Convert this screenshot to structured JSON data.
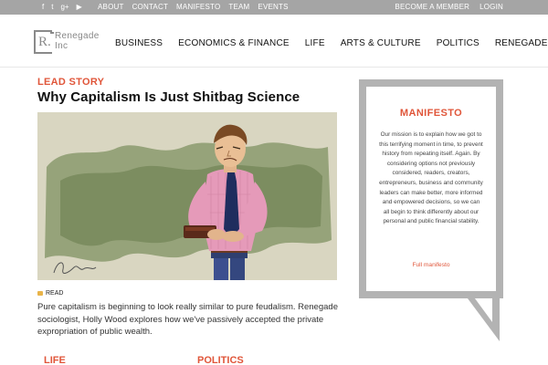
{
  "topbar": {
    "social": [
      {
        "name": "facebook-icon",
        "glyph": "f"
      },
      {
        "name": "twitter-icon",
        "glyph": "t"
      },
      {
        "name": "googleplus-icon",
        "glyph": "g+"
      },
      {
        "name": "youtube-icon",
        "glyph": "▶"
      }
    ],
    "links": [
      "ABOUT",
      "CONTACT",
      "MANIFESTO",
      "TEAM",
      "EVENTS"
    ],
    "become_member": "BECOME A MEMBER",
    "login": "LOGIN"
  },
  "logo": {
    "mark": "R.",
    "line1": "Renegade",
    "line2": "Inc"
  },
  "nav": [
    "BUSINESS",
    "ECONOMICS & FINANCE",
    "LIFE",
    "ARTS & CULTURE",
    "POLITICS",
    "RENEGADE TV"
  ],
  "lead": {
    "label": "LEAD STORY",
    "title": "Why Capitalism Is Just Shitbag Science",
    "read": "READ",
    "summary": "Pure capitalism is beginning to look really similar to pure feudalism. Renegade sociologist, Holly Wood explores how we've passively accepted the private expropriation of public wealth."
  },
  "sections": {
    "life": "LIFE",
    "politics": "POLITICS"
  },
  "manifesto": {
    "title": "MANIFESTO",
    "text": "Our mission is to explain how we got to this terrifying moment in time, to prevent history from repeating itself. Again. By considering options not previously considered, readers, creators, entrepreneurs, business and community leaders can make better, more informed and empowered decisions, so we can all begin to think differently about our personal and public financial stability.",
    "link": "Full manifesto"
  },
  "colors": {
    "accent": "#e0563a",
    "topbar": "#a5a5a5",
    "frame": "#b3b3b3"
  }
}
